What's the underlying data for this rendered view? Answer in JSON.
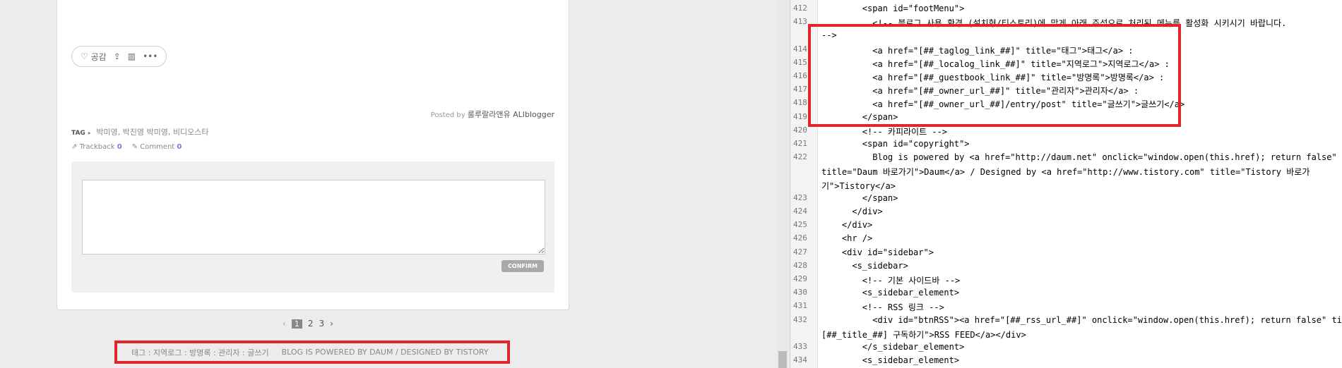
{
  "post": {
    "react_like": "공감",
    "posted_prefix": "Posted by",
    "posted_author": "룰루랄라앤유 ALIblogger",
    "tag_label": "TAG",
    "tags": "박미영, 박진영 박미영, 비디오스타",
    "trackback_label": "Trackback",
    "trackback_count": "0",
    "comment_label": "Comment",
    "comment_count": "0",
    "confirm_label": "CONFIRM"
  },
  "pager": {
    "prev": "‹",
    "pages": [
      "1",
      "2",
      "3"
    ],
    "next": "›"
  },
  "footer": {
    "menu": "태그 : 지역로그 : 방명록 : 관리자 : 글쓰기",
    "powered": "BLOG IS POWERED BY DAUM / DESIGNED BY TISTORY"
  },
  "colors": {
    "highlight_border": "#e0262a"
  },
  "code_lines": [
    {
      "n": "412",
      "t": "        <span id=\"footMenu\">"
    },
    {
      "n": "413",
      "t": "          <!-- 블로그 사용 환경 (설치형/티스토리)에 맞게 아래 주석으로 처리된 메뉴를 활성화 시키시기 바랍니다."
    },
    {
      "n": "",
      "t": "-->"
    },
    {
      "n": "414",
      "t": "          <a href=\"[##_taglog_link_##]\" title=\"태그\">태그</a> :"
    },
    {
      "n": "415",
      "t": "          <a href=\"[##_localog_link_##]\" title=\"지역로그\">지역로그</a> :"
    },
    {
      "n": "416",
      "t": "          <a href=\"[##_guestbook_link_##]\" title=\"방명록\">방명록</a> :"
    },
    {
      "n": "417",
      "t": "          <a href=\"[##_owner_url_##]\" title=\"관리자\">관리자</a> :"
    },
    {
      "n": "418",
      "t": "          <a href=\"[##_owner_url_##]/entry/post\" title=\"글쓰기\">글쓰기</a>"
    },
    {
      "n": "419",
      "t": "        </span>"
    },
    {
      "n": "420",
      "t": "        <!-- 카피라이트 -->"
    },
    {
      "n": "421",
      "t": "        <span id=\"copyright\">"
    },
    {
      "n": "422",
      "t": "          Blog is powered by <a href=\"http://daum.net\" onclick=\"window.open(this.href); return false\""
    },
    {
      "n": "",
      "t": "title=\"Daum 바로가기\">Daum</a> / Designed by <a href=\"http://www.tistory.com\" title=\"Tistory 바로가"
    },
    {
      "n": "",
      "t": "기\">Tistory</a>"
    },
    {
      "n": "423",
      "t": "        </span>"
    },
    {
      "n": "424",
      "t": "      </div>"
    },
    {
      "n": "425",
      "t": "    </div>"
    },
    {
      "n": "426",
      "t": "    <hr />"
    },
    {
      "n": "427",
      "t": "    <div id=\"sidebar\">"
    },
    {
      "n": "428",
      "t": "      <s_sidebar>"
    },
    {
      "n": "429",
      "t": "        <!-- 기본 사이드바 -->"
    },
    {
      "n": "430",
      "t": "        <s_sidebar_element>"
    },
    {
      "n": "431",
      "t": "        <!-- RSS 링크 -->"
    },
    {
      "n": "432",
      "t": "          <div id=\"btnRSS\"><a href=\"[##_rss_url_##]\" onclick=\"window.open(this.href); return false\" title=\""
    },
    {
      "n": "",
      "t": "[##_title_##] 구독하기\">RSS FEED</a></div>"
    },
    {
      "n": "433",
      "t": "        </s_sidebar_element>"
    },
    {
      "n": "434",
      "t": "        <s_sidebar_element>"
    }
  ]
}
